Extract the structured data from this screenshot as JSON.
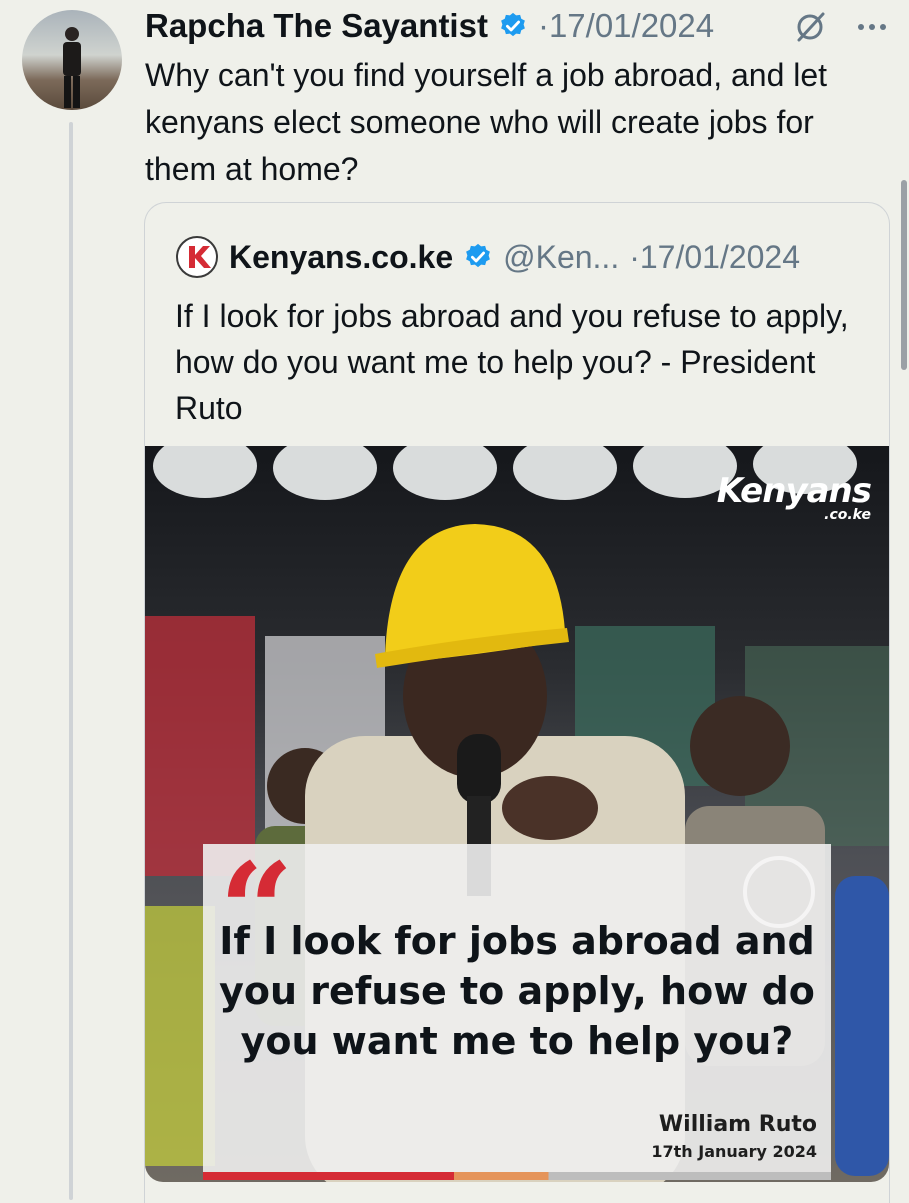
{
  "tweet": {
    "author_name": "Rapcha The Sayantist",
    "date": "·17/01/2024",
    "text": "Why can't you find yourself a job abroad, and let kenyans elect someone who will create jobs for them at home?"
  },
  "quoted_tweet": {
    "author_name": "Kenyans.co.ke",
    "handle": "@Ken...",
    "date": "·17/01/2024",
    "text": "If I look for jobs abroad and you refuse to apply, how do you want me to help you? - President Ruto",
    "image": {
      "brand": "Kenyans",
      "brand_sub": ".co.ke",
      "quote_mark": "“",
      "quote": "If I look for jobs abroad and you refuse to apply, how do you want me to help you?",
      "quote_author": "William Ruto",
      "quote_date": "17th January 2024"
    }
  },
  "colors": {
    "verified": "#1d9bf0",
    "quote_red": "#d52b35",
    "muted": "#657786",
    "helmet": "#f2cd19"
  },
  "icons": [
    "verified-icon",
    "grok-icon",
    "more-icon",
    "kenyans-logo-icon"
  ]
}
